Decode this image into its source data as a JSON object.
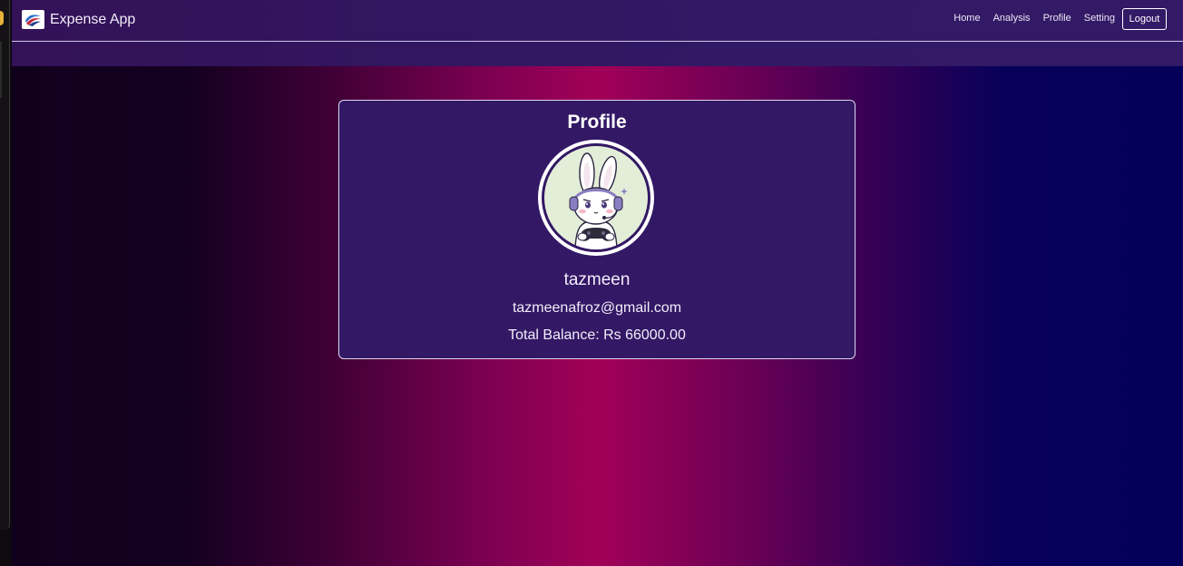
{
  "brand": {
    "title": "Expense App",
    "logo_icon": "wave-logo-icon"
  },
  "nav": {
    "links": [
      {
        "label": "Home"
      },
      {
        "label": "Analysis"
      },
      {
        "label": "Profile"
      },
      {
        "label": "Setting"
      }
    ],
    "logout_label": "Logout"
  },
  "profile": {
    "title": "Profile",
    "avatar_icon": "bunny-gamer-avatar",
    "username": "tazmeen",
    "email": "tazmeenafroz@gmail.com",
    "balance_text": "Total Balance: Rs 66000.00"
  },
  "colors": {
    "navbar": "#331865",
    "card": "#331865",
    "gradient_center": "#a20058",
    "gradient_right": "#04005a"
  }
}
